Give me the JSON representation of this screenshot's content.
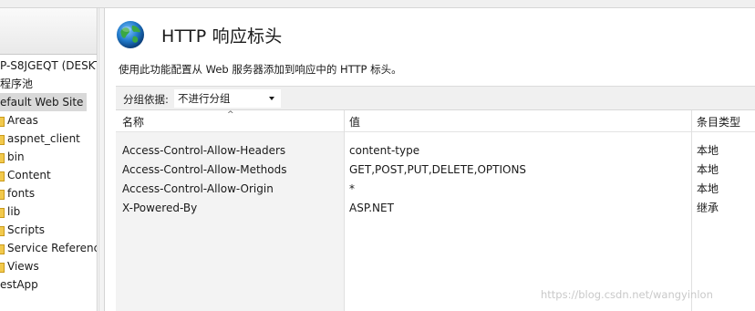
{
  "tree": {
    "items": [
      {
        "label": "P-S8JGEQT (DESKT",
        "indent": 0,
        "folder": false,
        "selected": false
      },
      {
        "label": "程序池",
        "indent": 0,
        "folder": false,
        "selected": false
      },
      {
        "label": "efault Web Site",
        "indent": 0,
        "folder": false,
        "selected": true
      },
      {
        "label": "Areas",
        "indent": 1,
        "folder": true,
        "selected": false
      },
      {
        "label": "aspnet_client",
        "indent": 1,
        "folder": true,
        "selected": false
      },
      {
        "label": "bin",
        "indent": 1,
        "folder": true,
        "selected": false
      },
      {
        "label": "Content",
        "indent": 1,
        "folder": true,
        "selected": false
      },
      {
        "label": "fonts",
        "indent": 1,
        "folder": true,
        "selected": false
      },
      {
        "label": "lib",
        "indent": 1,
        "folder": true,
        "selected": false
      },
      {
        "label": "Scripts",
        "indent": 1,
        "folder": true,
        "selected": false
      },
      {
        "label": "Service Reference",
        "indent": 1,
        "folder": true,
        "selected": false
      },
      {
        "label": "Views",
        "indent": 1,
        "folder": true,
        "selected": false
      },
      {
        "label": "estApp",
        "indent": 0,
        "folder": false,
        "selected": false
      }
    ]
  },
  "main": {
    "title": "HTTP 响应标头",
    "description": "使用此功能配置从 Web 服务器添加到响应中的 HTTP 标头。",
    "group": {
      "label": "分组依据:",
      "selected": "不进行分组"
    },
    "columns": {
      "name": "名称",
      "value": "值",
      "entry_type": "条目类型"
    },
    "rows": [
      {
        "name": "Access-Control-Allow-Headers",
        "value": "content-type",
        "entry_type": "本地"
      },
      {
        "name": "Access-Control-Allow-Methods",
        "value": "GET,POST,PUT,DELETE,OPTIONS",
        "entry_type": "本地"
      },
      {
        "name": "Access-Control-Allow-Origin",
        "value": "*",
        "entry_type": "本地"
      },
      {
        "name": "X-Powered-By",
        "value": "ASP.NET",
        "entry_type": "继承"
      }
    ]
  },
  "watermark": "https://blog.csdn.net/wangyinlon",
  "colors": {
    "globe": "#1f78c8",
    "land": "#3aa843",
    "folder": "#f2c94c",
    "selected_bg": "#d9d9d9"
  }
}
